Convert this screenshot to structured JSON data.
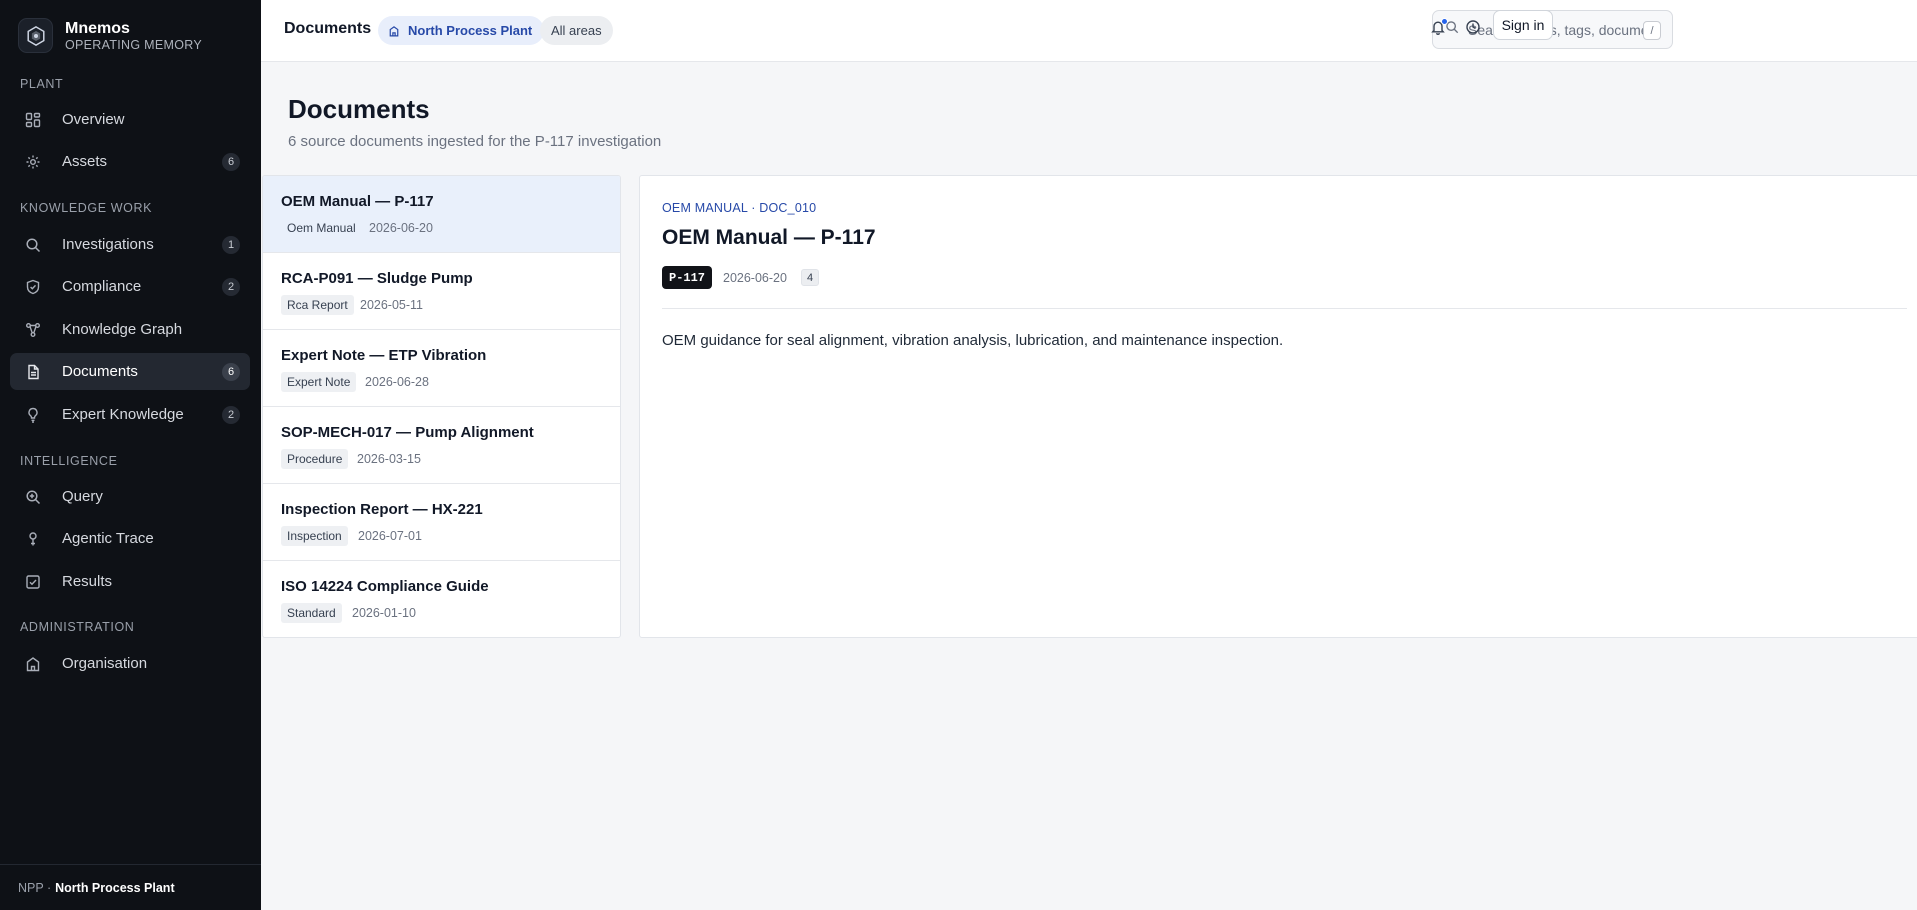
{
  "brand": {
    "name": "Mnemos",
    "subtitle": "OPERATING MEMORY"
  },
  "sidebar": {
    "sections": [
      {
        "label": "PLANT"
      },
      {
        "label": "KNOWLEDGE WORK"
      },
      {
        "label": "INTELLIGENCE"
      },
      {
        "label": "ADMINISTRATION"
      }
    ],
    "items": [
      {
        "label": "Overview",
        "icon": "grid-icon"
      },
      {
        "label": "Assets",
        "icon": "gear-icon",
        "count": "6"
      },
      {
        "label": "Investigations",
        "icon": "search-icon",
        "count": "1"
      },
      {
        "label": "Compliance",
        "icon": "shield-icon",
        "count": "2"
      },
      {
        "label": "Knowledge Graph",
        "icon": "graph-icon"
      },
      {
        "label": "Documents",
        "icon": "document-icon",
        "count": "6",
        "active": true
      },
      {
        "label": "Expert Knowledge",
        "icon": "lightbulb-icon",
        "count": "2"
      },
      {
        "label": "Query",
        "icon": "query-icon"
      },
      {
        "label": "Agentic Trace",
        "icon": "trace-icon"
      },
      {
        "label": "Results",
        "icon": "checkbox-icon"
      },
      {
        "label": "Organisation",
        "icon": "building-icon"
      }
    ],
    "footer": {
      "code": "NPP ·",
      "plant": "North Process Plant"
    }
  },
  "topbar": {
    "title": "Documents",
    "plant_chip": "North Process Plant",
    "areas_chip": "All areas",
    "search": {
      "placeholder": "Search assets, tags, documents...",
      "shortcut": "/"
    },
    "signin": "Sign in"
  },
  "page": {
    "title": "Documents",
    "subtitle": "6 source documents ingested for the P-117 investigation"
  },
  "documents": [
    {
      "title": "OEM Manual — P-117",
      "type": "Oem Manual",
      "date": "2026-06-20",
      "active": true
    },
    {
      "title": "RCA-P091 — Sludge Pump",
      "type": "Rca Report",
      "date": "2026-05-11"
    },
    {
      "title": "Expert Note — ETP Vibration",
      "type": "Expert Note",
      "date": "2026-06-28"
    },
    {
      "title": "SOP-MECH-017 — Pump Alignment",
      "type": "Procedure",
      "date": "2026-03-15"
    },
    {
      "title": "Inspection Report — HX-221",
      "type": "Inspection",
      "date": "2026-07-01"
    },
    {
      "title": "ISO 14224 Compliance Guide",
      "type": "Standard",
      "date": "2026-01-10"
    }
  ],
  "detail": {
    "kicker": "OEM MANUAL · DOC_010",
    "title": "OEM Manual — P-117",
    "tag": "P-117",
    "date": "2026-06-20",
    "count": "4",
    "body": "OEM guidance for seal alignment, vibration analysis, lubrication, and maintenance inspection."
  },
  "colors": {
    "sidebar_bg": "#0e1116",
    "accent": "#2749a8",
    "active_row": "#e9f0fb"
  }
}
